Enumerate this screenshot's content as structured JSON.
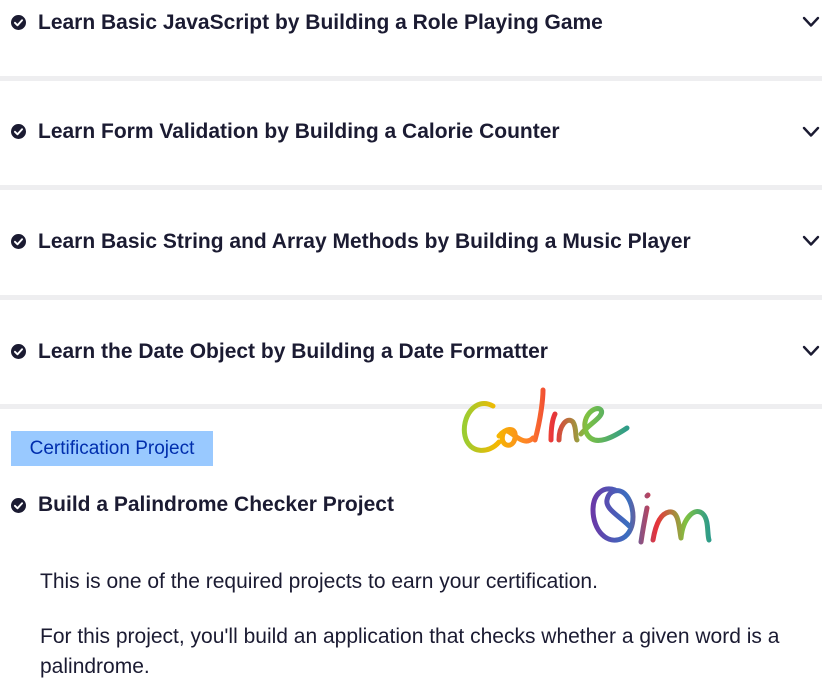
{
  "challenges": [
    {
      "title": "Learn Basic JavaScript by Building a Role Playing Game",
      "icon": "check-circle-icon",
      "expand_icon": "chevron-down-icon"
    },
    {
      "title": "Learn Form Validation by Building a Calorie Counter",
      "icon": "check-circle-icon",
      "expand_icon": "chevron-down-icon"
    },
    {
      "title": "Learn Basic String and Array Methods by Building a Music Player",
      "icon": "check-circle-icon",
      "expand_icon": "chevron-down-icon"
    },
    {
      "title": "Learn the Date Object by Building a Date Formatter",
      "icon": "check-circle-icon",
      "expand_icon": "chevron-down-icon"
    }
  ],
  "certification": {
    "badge": "Certification Project",
    "project_title": "Build a Palindrome Checker Project",
    "project_icon": "check-circle-icon",
    "description_1": "This is one of the required projects to earn your certification.",
    "description_2": "For this project, you'll build an application that checks whether a given word is a palindrome."
  },
  "signature": {
    "line_1": "Celine",
    "line_2": "Qin"
  },
  "colors": {
    "text": "#1b1b32",
    "separator": "#eeeef0",
    "badge_bg": "#99c9ff",
    "badge_text": "#002ead"
  }
}
